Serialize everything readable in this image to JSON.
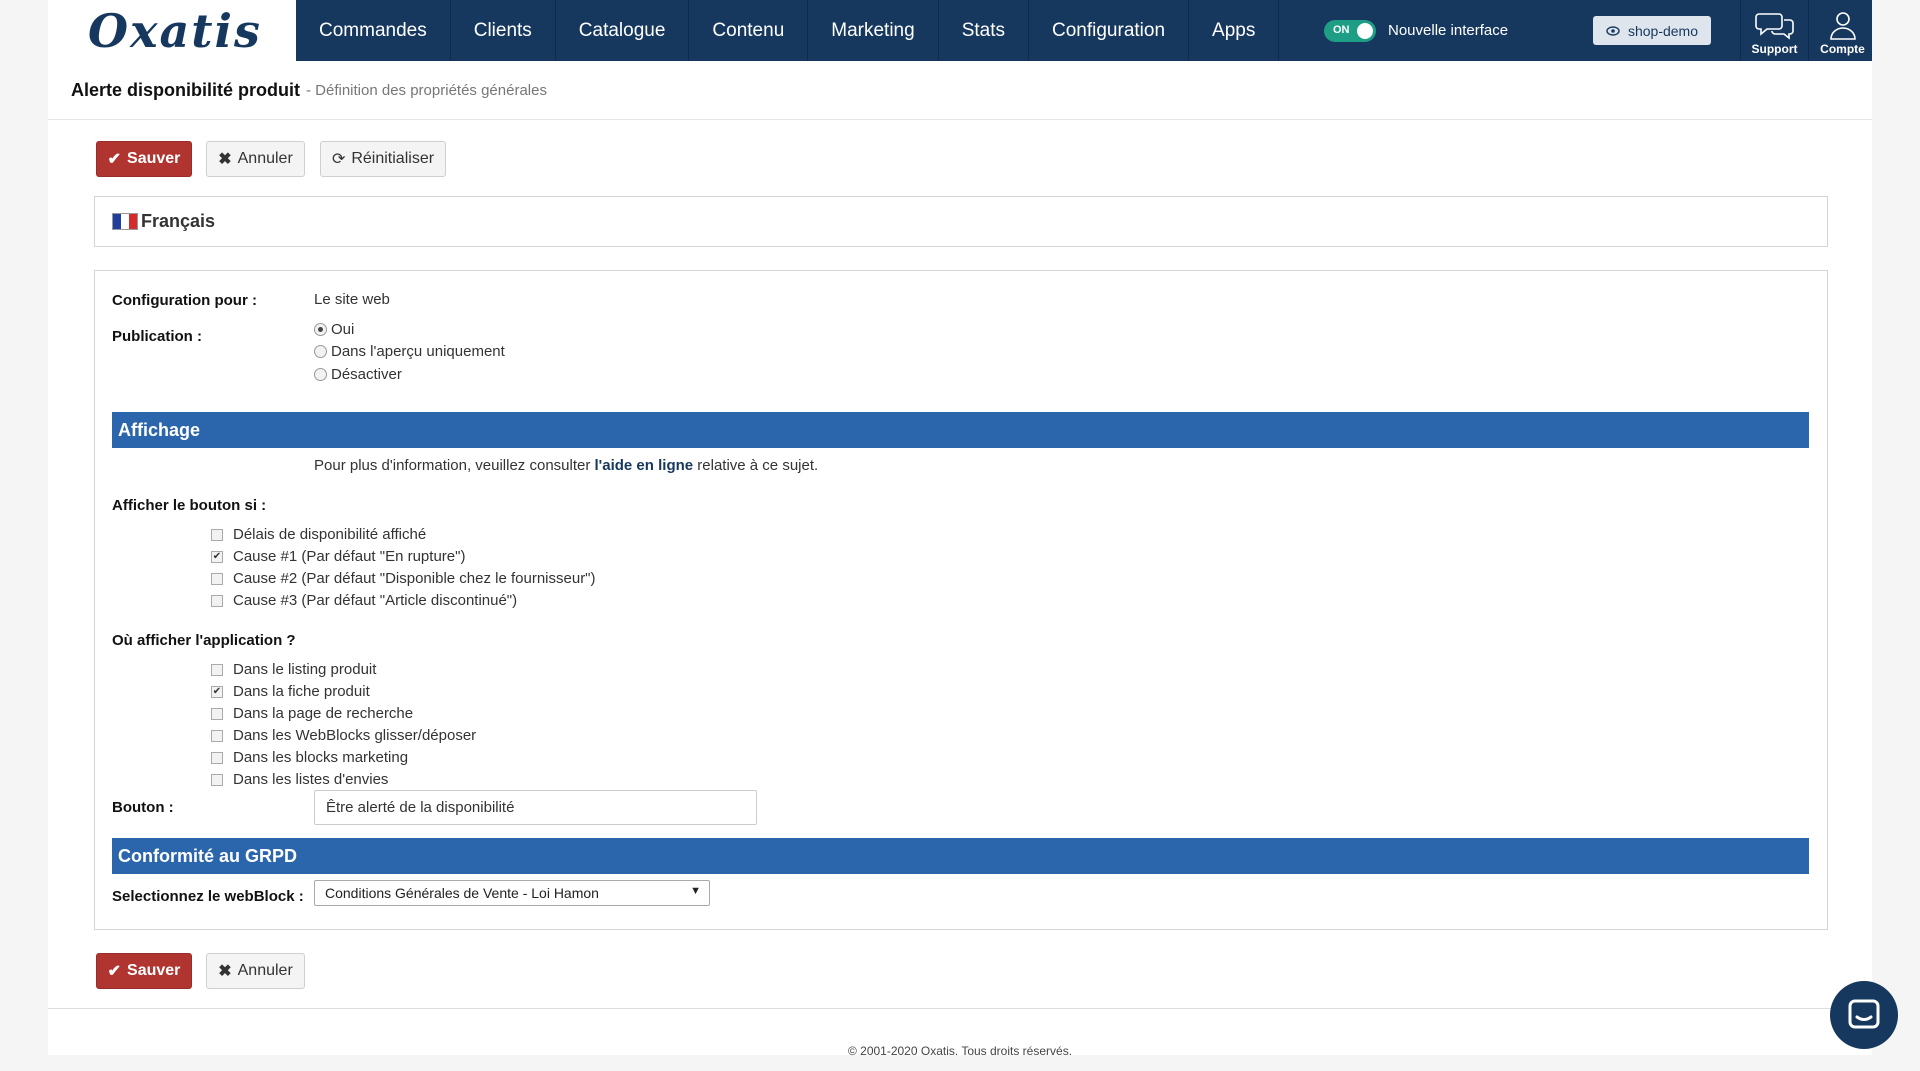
{
  "brand": {
    "logo": "Oxatis"
  },
  "nav": {
    "items": [
      "Commandes",
      "Clients",
      "Catalogue",
      "Contenu",
      "Marketing",
      "Stats",
      "Configuration",
      "Apps"
    ],
    "toggle_state": "ON",
    "toggle_text": "Nouvelle interface",
    "shop_label": "shop-demo",
    "support_label": "Support",
    "account_label": "Compte"
  },
  "header": {
    "title": "Alerte disponibilité produit",
    "subtitle": "- Définition des propriétés générales"
  },
  "toolbar": {
    "save": "Sauver",
    "cancel": "Annuler",
    "reset": "Réinitialiser"
  },
  "language": {
    "label": "Français"
  },
  "form": {
    "config_label": "Configuration pour :",
    "config_value": "Le site web",
    "publication_label": "Publication :",
    "publication_options": [
      "Oui",
      "Dans l'aperçu uniquement",
      "Désactiver"
    ],
    "publication_selected": "Oui",
    "display_section": "Affichage",
    "help_prefix": "Pour plus d'information, veuillez consulter ",
    "help_link": "l'aide en ligne",
    "help_suffix": " relative à ce sujet.",
    "show_button_label": "Afficher le bouton si :",
    "show_button_options": [
      {
        "label": "Délais de disponibilité affiché",
        "checked": false
      },
      {
        "label": "Cause #1 (Par défaut \"En rupture\")",
        "checked": true
      },
      {
        "label": "Cause #2 (Par défaut \"Disponible chez le fournisseur\")",
        "checked": false
      },
      {
        "label": "Cause #3 (Par défaut \"Article discontinué\")",
        "checked": false
      }
    ],
    "where_label": "Où afficher l'application ?",
    "where_options": [
      {
        "label": "Dans le listing produit",
        "checked": false
      },
      {
        "label": "Dans la fiche produit",
        "checked": true
      },
      {
        "label": "Dans la page de recherche",
        "checked": false
      },
      {
        "label": "Dans les WebBlocks glisser/déposer",
        "checked": false
      },
      {
        "label": "Dans les blocks marketing",
        "checked": false
      },
      {
        "label": "Dans les listes d'envies",
        "checked": false
      }
    ],
    "button_label": "Bouton :",
    "button_value": "Être alerté de la disponibilité",
    "gdpr_section": "Conformité au GRPD",
    "webblock_label": "Selectionnez le webBlock :",
    "webblock_value": "Conditions Générales de Vente - Loi Hamon"
  },
  "footer": {
    "copyright": "© 2001-2020 Oxatis. Tous droits réservés."
  },
  "colors": {
    "nav_bg": "#17385e",
    "primary_button": "#b03531",
    "section_bar": "#2b66ad",
    "toggle_on": "#1e9e84"
  }
}
